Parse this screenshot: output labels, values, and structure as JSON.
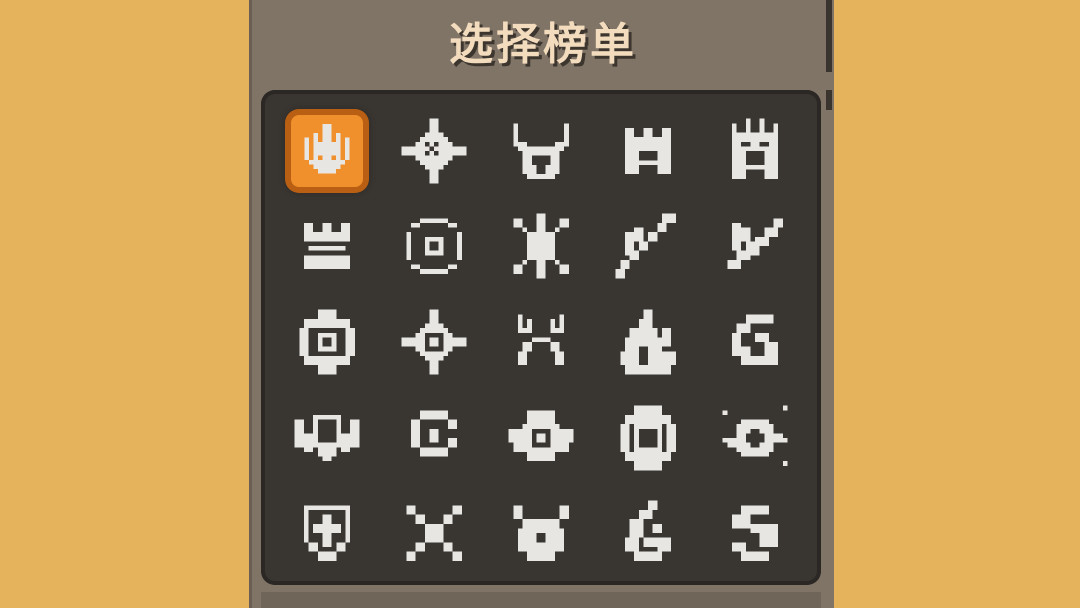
{
  "panel": {
    "title": "选择榜单"
  },
  "grid": {
    "selected_index": 0,
    "icons": [
      "emblem-dark-crown-icon",
      "compass-star-icon",
      "horned-helm-icon",
      "castle-gate-icon",
      "spiked-helm-icon",
      "tower-icon",
      "vortex-eye-icon",
      "crossed-arrows-icon",
      "double-blade-icon",
      "shard-blade-icon",
      "gear-shield-icon",
      "diamond-star-icon",
      "antler-icon",
      "flame-icon",
      "wave-swirl-icon",
      "winged-shield-icon",
      "spiral-icon",
      "winged-orb-icon",
      "black-hole-icon",
      "planet-orbit-icon",
      "cross-shield-icon",
      "crossed-swords-icon",
      "bull-head-icon",
      "fire-swirl-icon",
      "yin-wave-icon"
    ]
  },
  "colors": {
    "background": "#e4b35c",
    "panel": "#807466",
    "grid_bg": "#393531",
    "selected": "#f0902c",
    "icon": "#e8e6e2"
  }
}
